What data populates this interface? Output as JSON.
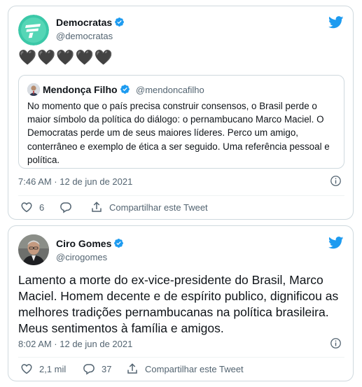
{
  "tweets": [
    {
      "author": {
        "name": "Democratas",
        "handle": "@democratas"
      },
      "text": "🖤🖤🖤🖤🖤",
      "quoted": {
        "author": {
          "name": "Mendonça Filho",
          "handle": "@mendoncafilho"
        },
        "text": "No momento que o país precisa construir consensos, o Brasil perde o maior símbolo da política do diálogo: o pernambucano Marco Maciel. O Democratas perde um de seus maiores líderes. Perco um amigo, conterrâneo e exemplo de ética a ser seguido. Uma referência pessoal e política."
      },
      "time": "7:46 AM · 12 de jun de 2021",
      "likes": "6",
      "share_label": "Compartilhar este Tweet"
    },
    {
      "author": {
        "name": "Ciro Gomes",
        "handle": "@cirogomes"
      },
      "text": "Lamento a morte do ex-vice-presidente do Brasil, Marco Maciel. Homem decente e de espírito publico, dignificou as melhores tradições pernambucanas na política brasileira. Meus sentimentos à família e amigos.",
      "time": "8:02 AM · 12 de jun de 2021",
      "likes": "2,1 mil",
      "replies": "37",
      "share_label": "Compartilhar este Tweet"
    }
  ],
  "colors": {
    "twitter_blue": "#1d9bf0",
    "border": "#cfd9de",
    "secondary_text": "#536471",
    "democratas_green": "#3bc8a8"
  },
  "icons": {
    "brand": "twitter-bird-icon",
    "verified": "verified-badge-icon",
    "info": "info-icon",
    "like": "heart-icon",
    "reply": "reply-bubble-icon",
    "share": "share-icon"
  }
}
